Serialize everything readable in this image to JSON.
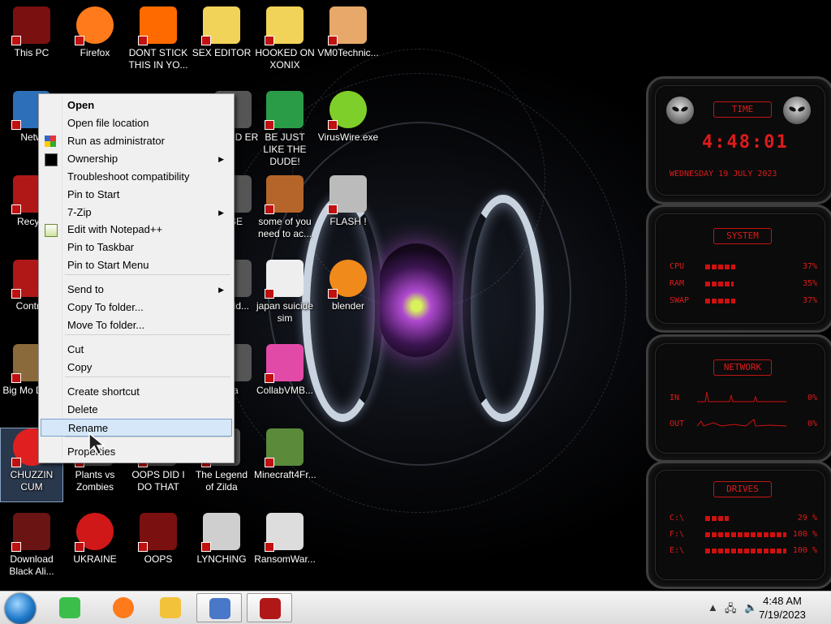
{
  "desktop_icons": [
    {
      "label": "This PC",
      "icon": "monitor-icon"
    },
    {
      "label": "Firefox",
      "icon": "firefox-icon"
    },
    {
      "label": "DONT STICK THIS IN YO...",
      "icon": "traffic-cone-icon"
    },
    {
      "label": "SEX EDITOR",
      "icon": "cartoon-face-icon"
    },
    {
      "label": "HOOKED ON XONIX",
      "icon": "cartoon-face-icon"
    },
    {
      "label": "VM0Technic...",
      "icon": "doctor-icon"
    },
    {
      "label": "Netw",
      "icon": "network-icon"
    },
    {
      "label": "BOARD ER",
      "icon": "app-icon"
    },
    {
      "label": "BE JUST LIKE THE DUDE!",
      "icon": "santa-icon"
    },
    {
      "label": "VirusWire.exe",
      "icon": "lime-icon"
    },
    {
      "label": "Recycl",
      "icon": "recycle-bin-icon"
    },
    {
      "label": "PSE",
      "icon": "app-icon"
    },
    {
      "label": "some of you need to ac...",
      "icon": "beaver-icon"
    },
    {
      "label": "FLASH !",
      "icon": "flash-icon"
    },
    {
      "label": "Control",
      "icon": "control-panel-icon"
    },
    {
      "label": "are ld...",
      "icon": "app-icon"
    },
    {
      "label": "japan suicide sim",
      "icon": "document-icon"
    },
    {
      "label": "blender",
      "icon": "blender-icon"
    },
    {
      "label": "Big Mo Delux",
      "icon": "money-bag-icon"
    },
    {
      "label": "da",
      "icon": "app-icon"
    },
    {
      "label": "CollabVMB...",
      "icon": "monitor-pink-icon"
    },
    {
      "label": "CHUZZIN CUM",
      "icon": "chuzzle-icon"
    },
    {
      "label": "Plants vs Zombies",
      "icon": "app-icon"
    },
    {
      "label": "OOPS DID I DO THAT",
      "icon": "app-icon"
    },
    {
      "label": "The Legend of Zilda",
      "icon": "app-icon"
    },
    {
      "label": "Minecraft4Fr...",
      "icon": "minecraft-block-icon"
    },
    {
      "label": "Download Black Ali...",
      "icon": "alien-icon"
    },
    {
      "label": "UKRAINE",
      "icon": "radiation-icon"
    },
    {
      "label": "OOPS",
      "icon": "alienware-icon"
    },
    {
      "label": "LYNCHING",
      "icon": "noose-icon"
    },
    {
      "label": "RansomWar...",
      "icon": "skull-icon"
    }
  ],
  "context_menu": {
    "items": [
      {
        "label": "Open",
        "bold": true
      },
      {
        "label": "Open file location"
      },
      {
        "label": "Run as administrator",
        "icon": "shield-icon"
      },
      {
        "label": "Ownership",
        "icon": "cmd-icon",
        "submenu": true
      },
      {
        "label": "Troubleshoot compatibility"
      },
      {
        "label": "Pin to Start"
      },
      {
        "label": "7-Zip",
        "submenu": true
      },
      {
        "label": "Edit with Notepad++",
        "icon": "notepad-icon"
      },
      {
        "label": "Pin to Taskbar"
      },
      {
        "label": "Pin to Start Menu"
      },
      {
        "label": "Send to",
        "submenu": true
      },
      {
        "label": "Copy To folder..."
      },
      {
        "label": "Move To folder..."
      },
      {
        "label": "Cut"
      },
      {
        "label": "Copy"
      },
      {
        "label": "Create shortcut"
      },
      {
        "label": "Delete"
      },
      {
        "label": "Rename",
        "highlighted": true
      },
      {
        "label": "Properties"
      }
    ]
  },
  "widgets": {
    "time": {
      "title": "TIME",
      "clock": "4:48:01",
      "date": "WEDNESDAY 19 JULY 2023"
    },
    "system": {
      "title": "SYSTEM",
      "rows": [
        {
          "label": "CPU",
          "value": "37%",
          "level": 0.37
        },
        {
          "label": "RAM",
          "value": "35%",
          "level": 0.35
        },
        {
          "label": "SWAP",
          "value": "37%",
          "level": 0.37
        }
      ]
    },
    "network": {
      "title": "NETWORK",
      "rows": [
        {
          "label": "IN",
          "value": "0%"
        },
        {
          "label": "OUT",
          "value": "0%"
        }
      ]
    },
    "drives": {
      "title": "DRIVES",
      "rows": [
        {
          "label": "C:\\",
          "value": "29 %",
          "level": 0.29
        },
        {
          "label": "F:\\",
          "value": "100 %",
          "level": 1.0
        },
        {
          "label": "E:\\",
          "value": "100 %",
          "level": 1.0
        }
      ]
    }
  },
  "taskbar": {
    "pinned": [
      "notes-icon",
      "firefox-icon",
      "file-explorer-icon",
      "computer-icon",
      "alienware-icon"
    ],
    "clock_time": "4:48 AM",
    "clock_date": "7/19/2023"
  },
  "colors": {
    "accent_red": "#e01a1a",
    "menu_highlight": "#d5e7f8"
  }
}
